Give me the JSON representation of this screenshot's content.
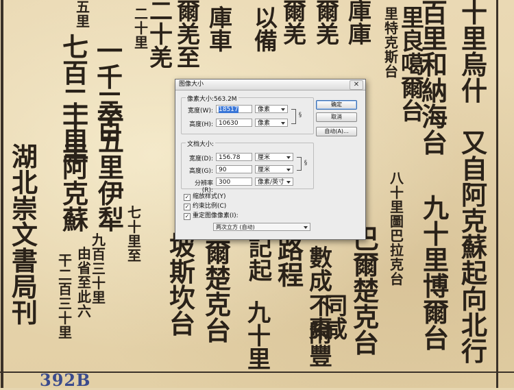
{
  "background_text": {
    "columns": [
      "五里",
      "七百二十里",
      "一千三百",
      "卒五里伊犁",
      "湖北崇文書局刊",
      "十里阿克蘇",
      "由省至此六",
      "九百三十里",
      "干二百三十里",
      "七十里至",
      "坡斯坎台",
      "二十里",
      "二十羌",
      "爾羌至",
      "庫車",
      "以備",
      "爾羌",
      "爾羌",
      "記起",
      "爾楚克台",
      "路程",
      "九十里",
      "數成",
      "不棗",
      "同咸",
      "附豐",
      "庫庫",
      "巴爾楚克台",
      "八十里圖巴拉克台",
      "里特克斯台",
      "百里和納海台",
      "里良噶爾台",
      "九十里博爾台",
      "十里烏什",
      "又自阿克蘇起向北行"
    ],
    "stamp": "392B"
  },
  "dialog": {
    "title": "图像大小",
    "close_icon": "close-icon",
    "pixel_dimensions": {
      "label": "像素大小:563.2M",
      "width_label": "宽度(W):",
      "width_value": "18517",
      "width_unit": "像素",
      "height_label": "高度(H):",
      "height_value": "10630",
      "height_unit": "像素"
    },
    "document_size": {
      "label": "文档大小:",
      "width_label": "宽度(D):",
      "width_value": "156.78",
      "width_unit": "厘米",
      "height_label": "高度(G):",
      "height_value": "90",
      "height_unit": "厘米",
      "resolution_label": "分辨率(R):",
      "resolution_value": "300",
      "resolution_unit": "像素/英寸"
    },
    "checkboxes": {
      "scale_styles": {
        "label": "缩放样式(Y)",
        "checked": true
      },
      "constrain": {
        "label": "约束比例(C)",
        "checked": true
      },
      "resample": {
        "label": "重定图像像素(I):",
        "checked": true
      }
    },
    "resample_method": "两次立方 (自动)",
    "buttons": {
      "ok": "确定",
      "cancel": "取消",
      "auto": "自动(A)..."
    }
  }
}
